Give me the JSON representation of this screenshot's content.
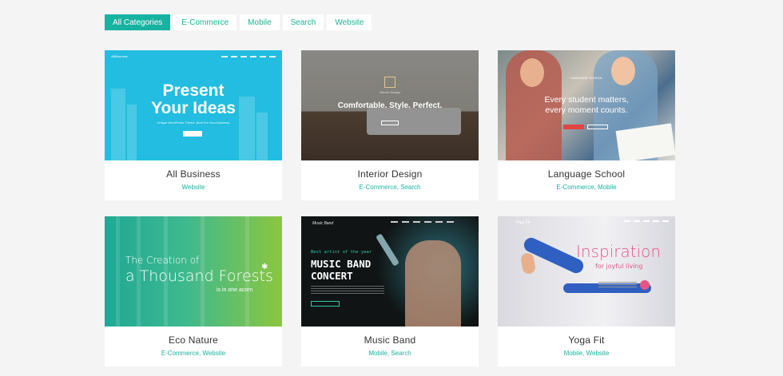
{
  "filters": [
    "All Categories",
    "E-Commerce",
    "Mobile",
    "Search",
    "Website"
  ],
  "active_filter": "All Categories",
  "cards": [
    {
      "title": "All Business",
      "tags": "Website",
      "preview": {
        "logo": "AllBusiness",
        "headline_1": "Present",
        "headline_2": "Your Ideas",
        "subtitle": "Unique WordPress Theme, Best For Your Business"
      }
    },
    {
      "title": "Interior Design",
      "tags": "E-Commerce, Search",
      "preview": {
        "brand": "Interior Design",
        "headline": "Comfortable. Style. Perfect."
      }
    },
    {
      "title": "Language School",
      "tags": "E-Commerce, Mobile",
      "preview": {
        "kicker": "LANGUAGE SCHOOL",
        "line_1": "Every student matters,",
        "line_2": "every moment counts."
      }
    },
    {
      "title": "Eco Nature",
      "tags": "E-Commerce, Website",
      "preview": {
        "line_1": "The Creation of",
        "line_2": "a Thousand Forests",
        "line_3": "is in one acorn"
      }
    },
    {
      "title": "Music Band",
      "tags": "Mobile, Search",
      "preview": {
        "logo": "Music Band",
        "kicker": "Best artist of the year",
        "line_1": "MUSIC BAND",
        "line_2": "CONCERT"
      }
    },
    {
      "title": "Yoga Fit",
      "tags": "Mobile, Website",
      "preview": {
        "logo": "Yoga Fit",
        "headline": "Inspiration",
        "subtitle": "for joyful living"
      }
    }
  ],
  "colors": {
    "accent": "#17b3a0",
    "page_bg": "#f4f4f4",
    "card_bg": "#ffffff"
  }
}
